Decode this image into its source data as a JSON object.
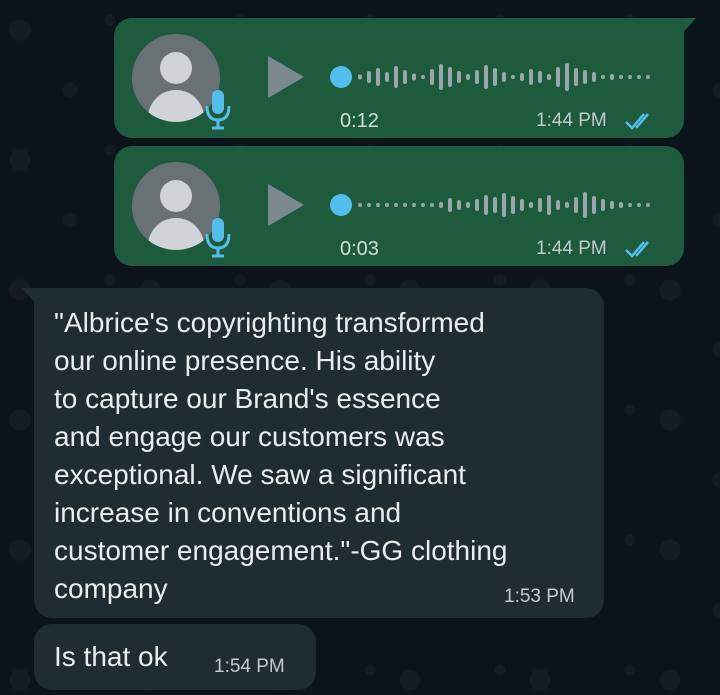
{
  "conversation": {
    "voice_messages": [
      {
        "duration": "0:12",
        "time": "1:44 PM",
        "status_icon": "double-check-read-icon",
        "progress": 0
      },
      {
        "duration": "0:03",
        "time": "1:44 PM",
        "status_icon": "double-check-read-icon",
        "progress": 0
      }
    ],
    "incoming_messages": [
      {
        "text": "\"Albrice's copyrighting transformed\nour online presence. His ability\nto capture our Brand's essence\nand engage our customers was\nexceptional. We saw a significant\nincrease in conventions and\ncustomer engagement.\"-GG clothing\ncompany",
        "time": "1:53 PM"
      },
      {
        "text": "Is that ok",
        "time": "1:54 PM"
      }
    ]
  },
  "colors": {
    "background": "#0b141a",
    "outgoing_bubble": "#1e5a3c",
    "incoming_bubble": "#202c33",
    "accent_blue": "#53bdeb",
    "text_primary": "#e9edef",
    "text_secondary": "#c3cacd"
  },
  "icons": {
    "avatar": "person-avatar-icon",
    "mic": "mic-icon",
    "play": "play-icon",
    "read_receipt": "double-check-read-icon"
  }
}
